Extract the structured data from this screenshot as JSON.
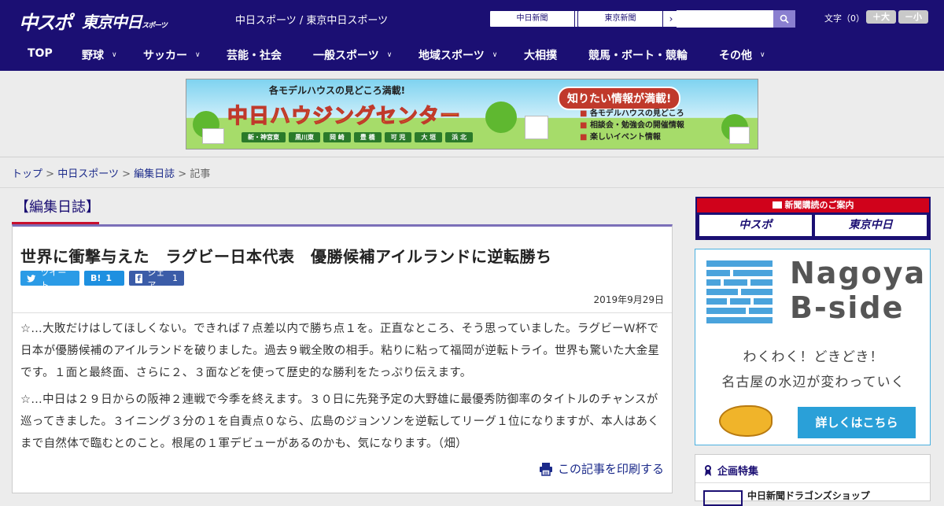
{
  "header": {
    "logo_chuspo": "中スポ",
    "logo_tokyo": "東京中日",
    "logo_tokyo_small": "スポーツ",
    "site_name": "中日スポーツ / 東京中日スポーツ",
    "paper_links": [
      "中日新聞",
      "東京新聞"
    ],
    "search_placeholder": "",
    "font_label": "文字（0）",
    "font_bigger": "＋大",
    "font_smaller": "－小"
  },
  "nav": {
    "items": [
      {
        "label": "TOP",
        "has_menu": false
      },
      {
        "label": "野球",
        "has_menu": true
      },
      {
        "label": "サッカー",
        "has_menu": true
      },
      {
        "label": "芸能・社会",
        "has_menu": false
      },
      {
        "label": "一般スポーツ",
        "has_menu": true
      },
      {
        "label": "地域スポーツ",
        "has_menu": true
      },
      {
        "label": "大相撲",
        "has_menu": false
      },
      {
        "label": "競馬・ボート・競輪",
        "has_menu": false
      },
      {
        "label": "その他",
        "has_menu": true
      }
    ]
  },
  "banner": {
    "top_text": "各モデルハウスの見どころ満載!",
    "title": "中日ハウジングセンター",
    "cities": [
      "新・神宮東",
      "黒川東",
      "岡 崎",
      "豊 橋",
      "可 児",
      "大 垣",
      "浜 北"
    ],
    "bubble": "知りたい情報が満載!",
    "points": [
      "各モデルハウスの見どころ",
      "相談会・勉強会の開催情報",
      "楽しいイベント情報"
    ]
  },
  "breadcrumb": {
    "items": [
      "トップ",
      "中日スポーツ",
      "編集日誌"
    ],
    "current": "記事",
    "separator": ">"
  },
  "section_title": "【編集日誌】",
  "article": {
    "headline": "世界に衝撃与えた　ラグビー日本代表　優勝候補アイルランドに逆転勝ち",
    "share": {
      "tweet": "ツイート",
      "hatena_label": "B!",
      "hatena_count": "1",
      "facebook_label": "シェア",
      "facebook_count": "1"
    },
    "date": "2019年9月29日",
    "paragraphs": [
      "☆…大敗だけはしてほしくない。できれば７点差以内で勝ち点１を。正直なところ、そう思っていました。ラグビーＷ杯で日本が優勝候補のアイルランドを破りました。過去９戦全敗の相手。粘りに粘って福岡が逆転トライ。世界も驚いた大金星です。１面と最終面、さらに２、３面などを使って歴史的な勝利をたっぷり伝えます。",
      "☆…中日は２９日からの阪神２連戦で今季を終えます。３０日に先発予定の大野雄に最優秀防御率のタイトルのチャンスが巡ってきました。３イニング３分の１を自責点０なら、広島のジョンソンを逆転してリーグ１位になりますが、本人はあくまで自然体で臨むとのこと。根尾の１軍デビューがあるのかも、気になります。（畑）"
    ],
    "print_label": "この記事を印刷する"
  },
  "sidebar": {
    "subscribe_head": "新聞購読のご案内",
    "subscribe_logos": [
      "中スポ",
      "東京中日"
    ],
    "nagoya": {
      "title_1": "Nagoya",
      "title_2": "B-side",
      "line_1": "わくわく！どきどき！",
      "line_2": "名古屋の水辺が変わっていく",
      "button": "詳しくはこちら"
    },
    "kikaku": {
      "head": "企画特集",
      "item": "中日新聞ドラゴンズショップ"
    }
  },
  "colors": {
    "brand_navy": "#1b0f73",
    "accent_red": "#c8102e",
    "link": "#1b2a8a"
  }
}
